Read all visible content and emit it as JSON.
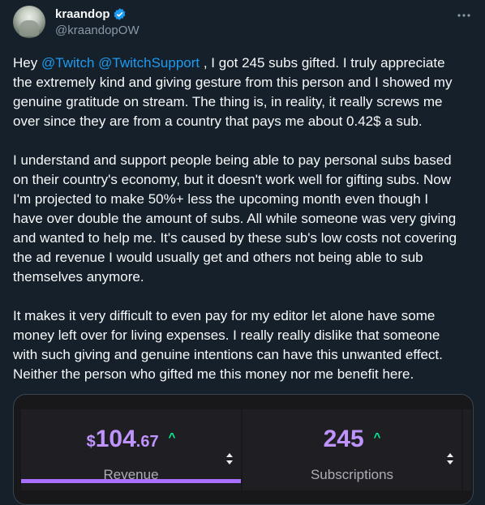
{
  "user": {
    "display_name": "kraandop",
    "handle": "@kraandopOW",
    "verified": true
  },
  "tweet": {
    "intro": "Hey ",
    "mention1": "@Twitch",
    "space": " ",
    "mention2": "@TwitchSupport",
    "p1_rest": " , I got 245 subs gifted. I truly appreciate\nthe extremely kind and giving gesture from this person and I showed my\ngenuine gratitude on stream. The thing is, in reality, it really screws me\nover since they are from a country that pays me about 0.42$ a sub.\n\nI understand and support people being able to pay personal subs based\non their country's economy, but it doesn't work well for gifting subs. Now\nI'm projected to make 50%+ less the upcoming month even though I\nhave over double the amount of subs. All while someone was very giving\nand wanted to help me. It's caused by these sub's low costs not covering\nthe ad revenue I would usually get and others not being able to sub\nthemselves anymore.\n\nIt makes it very difficult to even pay for my editor let alone have some\nmoney left over for living expenses. I really really dislike that someone\nwith such giving and genuine intentions can have this unwanted effect.\nNeither the person who gifted me this money nor me benefit here."
  },
  "stats": {
    "revenue": {
      "currency": "$",
      "dollars": "104",
      "cents": ".67",
      "trend": "^",
      "label": "Revenue"
    },
    "subscriptions": {
      "value": "245",
      "trend": "^",
      "label": "Subscriptions"
    }
  },
  "colors": {
    "background": "#15202b",
    "mention": "#1d9bf0",
    "accent_purple": "#a970ff",
    "value_purple": "#bf94ff",
    "trend_green": "#00f593"
  },
  "icons": [
    "verified-badge-icon",
    "more-options-icon",
    "sort-arrows-icon",
    "trend-up-icon"
  ]
}
